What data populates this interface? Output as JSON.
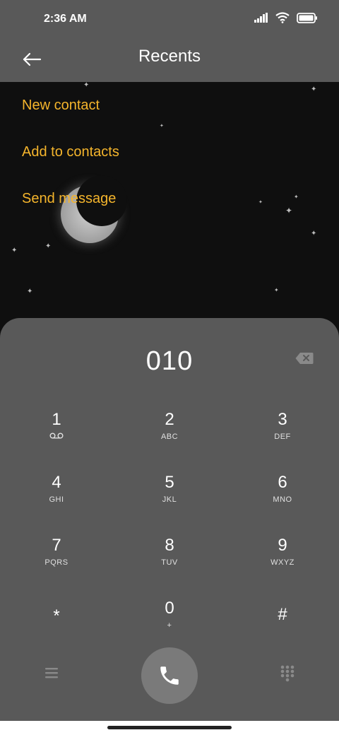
{
  "status_bar": {
    "time": "2:36 AM"
  },
  "header": {
    "title": "Recents"
  },
  "actions": [
    "New contact",
    "Add to contacts",
    "Send message"
  ],
  "dialer": {
    "number": "010",
    "keys": [
      {
        "digit": "1",
        "letters": ""
      },
      {
        "digit": "2",
        "letters": "ABC"
      },
      {
        "digit": "3",
        "letters": "DEF"
      },
      {
        "digit": "4",
        "letters": "GHI"
      },
      {
        "digit": "5",
        "letters": "JKL"
      },
      {
        "digit": "6",
        "letters": "MNO"
      },
      {
        "digit": "7",
        "letters": "PQRS"
      },
      {
        "digit": "8",
        "letters": "TUV"
      },
      {
        "digit": "9",
        "letters": "WXYZ"
      },
      {
        "digit": "*",
        "letters": ""
      },
      {
        "digit": "0",
        "letters": "+"
      },
      {
        "digit": "#",
        "letters": ""
      }
    ]
  },
  "colors": {
    "accent": "#f5b52c",
    "panel": "#595959",
    "background": "#0f0f0f",
    "call_button": "#7a7a7a"
  },
  "icons": [
    "back-arrow-icon",
    "signal-icon",
    "wifi-icon",
    "battery-icon",
    "voicemail-icon",
    "backspace-icon",
    "phone-icon",
    "menu-icon",
    "dialpad-icon"
  ]
}
